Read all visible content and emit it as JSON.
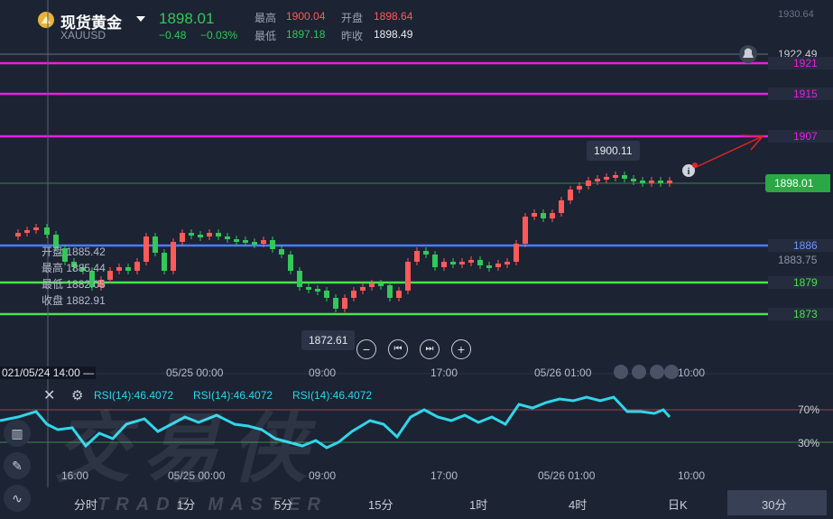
{
  "header": {
    "title": "现货黄金",
    "symbol": "XAUUSD",
    "price": "1898.01",
    "change": "−0.48",
    "change_pct": "−0.03%",
    "high_label": "最高",
    "high": "1900.04",
    "open_label": "开盘",
    "open": "1898.64",
    "low_label": "最低",
    "low": "1897.18",
    "prev_label": "昨收",
    "prev": "1898.49"
  },
  "levels": {
    "top_right": "1930.64",
    "l1922": "1922.49",
    "l1921": "1921",
    "l1915": "1915",
    "l1907": "1907",
    "current": "1898.01",
    "l1886": "1886",
    "l1883": "1883.75",
    "l1879": "1879",
    "l1873": "1873"
  },
  "ohlc_panel": {
    "open_label": "开盘",
    "open": "1885.42",
    "high_label": "最高",
    "high": "1885.44",
    "low_label": "最低",
    "low": "1882.05",
    "close_label": "收盘",
    "close": "1882.91"
  },
  "tooltips": {
    "peak": "1900.11",
    "low": "1872.61"
  },
  "time_axis": [
    "021/05/24 14:00 —",
    "05/25 00:00",
    "09:00",
    "17:00",
    "05/26 01:00",
    "10:00"
  ],
  "rsi": {
    "labels": [
      "RSI(14):46.4072",
      "RSI(14):46.4072",
      "RSI(14):46.4072"
    ],
    "upper": "70%",
    "lower": "30%",
    "time_axis": [
      "16:00",
      "05/25 00:00",
      "09:00",
      "17:00",
      "05/26 01:00",
      "10:00"
    ]
  },
  "controls": {
    "zoom_out": "−",
    "prev": "⏮",
    "next": "⏭",
    "zoom_in": "+"
  },
  "tabs": [
    "分时",
    "1分",
    "5分",
    "15分",
    "1时",
    "4时",
    "日K",
    "30分"
  ],
  "watermark": {
    "cn": "交易侠",
    "en": "TRADE MASTER"
  },
  "colors": {
    "up": "#ff5a5a",
    "down": "#34c759",
    "magenta": "#e81fe0",
    "blue": "#4a7dff",
    "green_line": "#49e24a",
    "rsi": "#30d5ea"
  }
}
